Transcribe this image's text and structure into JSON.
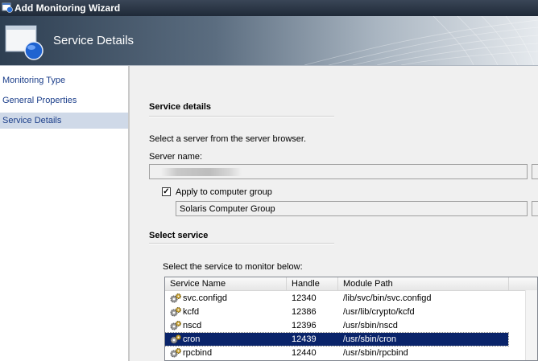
{
  "window": {
    "title": "Add Monitoring Wizard"
  },
  "banner": {
    "title": "Service Details"
  },
  "nav": {
    "items": [
      {
        "label": "Monitoring Type"
      },
      {
        "label": "General Properties"
      },
      {
        "label": "Service Details"
      }
    ]
  },
  "service_details": {
    "heading": "Service details",
    "instruction": "Select a server from the server browser.",
    "server_label": "Server name:",
    "server_value": "",
    "apply_group_label": "Apply to computer group",
    "apply_group_checked": true,
    "group_value": "Solaris Computer Group"
  },
  "select_service": {
    "heading": "Select service",
    "instruction": "Select the service to monitor below:",
    "columns": [
      "Service Name",
      "Handle",
      "Module Path"
    ],
    "rows": [
      {
        "name": "svc.configd",
        "handle": "12340",
        "path": "/lib/svc/bin/svc.configd"
      },
      {
        "name": "kcfd",
        "handle": "12386",
        "path": "/usr/lib/crypto/kcfd"
      },
      {
        "name": "nscd",
        "handle": "12396",
        "path": "/usr/sbin/nscd"
      },
      {
        "name": "cron",
        "handle": "12439",
        "path": "/usr/sbin/cron"
      },
      {
        "name": "rpcbind",
        "handle": "12440",
        "path": "/usr/sbin/rpcbind"
      },
      {
        "name": "",
        "handle": "",
        "path": ""
      }
    ],
    "selected_row": 3
  },
  "colors": {
    "nav_link": "#1b3e8a",
    "nav_selected_bg": "#cfd9e8",
    "row_selected_bg": "#0a246a"
  },
  "icons": {
    "window": "wizard-window-icon",
    "banner": "wizard-globe-icon",
    "service": "gears-icon"
  }
}
